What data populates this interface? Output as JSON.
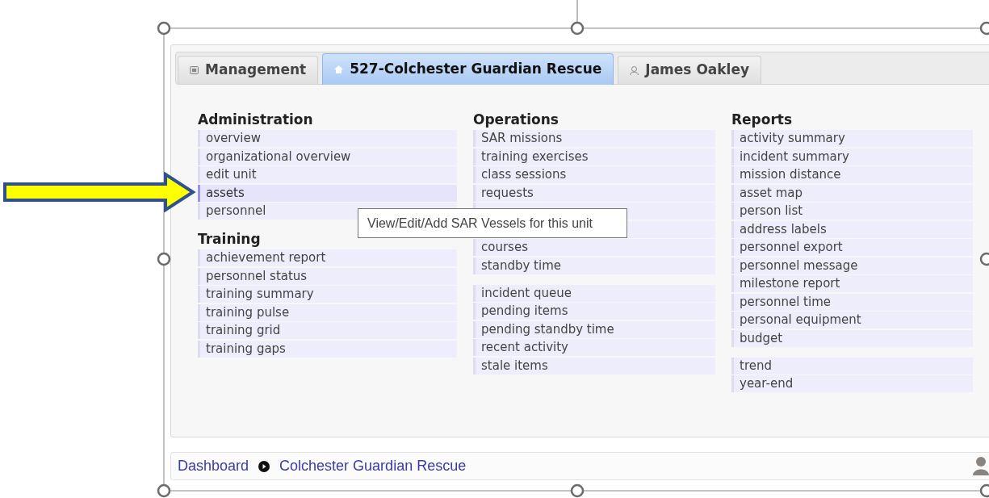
{
  "tabs": [
    {
      "label": "Management",
      "selected": false
    },
    {
      "label": "527-Colchester Guardian Rescue",
      "selected": true
    },
    {
      "label": "James Oakley",
      "selected": false
    }
  ],
  "columns": [
    {
      "sections": [
        {
          "heading": "Administration",
          "groups": [
            [
              {
                "label": "overview",
                "hovered": false
              },
              {
                "label": "organizational overview",
                "hovered": false
              },
              {
                "label": "edit unit",
                "hovered": false
              },
              {
                "label": "assets",
                "hovered": true
              },
              {
                "label": "personnel",
                "hovered": false
              }
            ]
          ]
        },
        {
          "heading": "Training",
          "groups": [
            [
              {
                "label": "achievement report",
                "hovered": false
              },
              {
                "label": "personnel status",
                "hovered": false
              },
              {
                "label": "training summary",
                "hovered": false
              },
              {
                "label": "training pulse",
                "hovered": false
              },
              {
                "label": "training grid",
                "hovered": false
              },
              {
                "label": "training gaps",
                "hovered": false
              }
            ]
          ]
        }
      ]
    },
    {
      "sections": [
        {
          "heading": "Operations",
          "groups": [
            [
              {
                "kind": "link",
                "label": "SAR missions",
                "hovered": false
              },
              {
                "kind": "link",
                "label": "training exercises",
                "hovered": false
              },
              {
                "kind": "link",
                "label": "class sessions",
                "hovered": false
              },
              {
                "kind": "link",
                "label": "requests",
                "hovered": false
              },
              {
                "kind": "covered"
              },
              {
                "kind": "covered"
              },
              {
                "kind": "link",
                "label": "courses",
                "hovered": false
              },
              {
                "kind": "link",
                "label": "standby time",
                "hovered": false
              }
            ],
            [
              {
                "label": "incident queue",
                "hovered": false
              },
              {
                "label": "pending items",
                "hovered": false
              },
              {
                "label": "pending standby time",
                "hovered": false
              },
              {
                "label": "recent activity",
                "hovered": false
              },
              {
                "label": "stale items",
                "hovered": false
              }
            ]
          ]
        }
      ]
    },
    {
      "sections": [
        {
          "heading": "Reports",
          "groups": [
            [
              {
                "label": "activity summary",
                "hovered": false
              },
              {
                "label": "incident summary",
                "hovered": false
              },
              {
                "label": "mission distance",
                "hovered": false
              },
              {
                "label": "asset map",
                "hovered": false
              },
              {
                "label": "person list",
                "hovered": false
              },
              {
                "label": "address labels",
                "hovered": false
              },
              {
                "label": "personnel export",
                "hovered": false
              },
              {
                "label": "personnel message",
                "hovered": false
              },
              {
                "label": "milestone report",
                "hovered": false
              },
              {
                "label": "personnel time",
                "hovered": false
              },
              {
                "label": "personal equipment",
                "hovered": false
              },
              {
                "label": "budget",
                "hovered": false
              }
            ],
            [
              {
                "label": "trend",
                "hovered": false
              },
              {
                "label": "year-end",
                "hovered": false
              }
            ]
          ]
        }
      ]
    }
  ],
  "tooltip": "View/Edit/Add SAR Vessels for this unit",
  "breadcrumb": [
    "Dashboard",
    "Colchester Guardian Rescue"
  ]
}
